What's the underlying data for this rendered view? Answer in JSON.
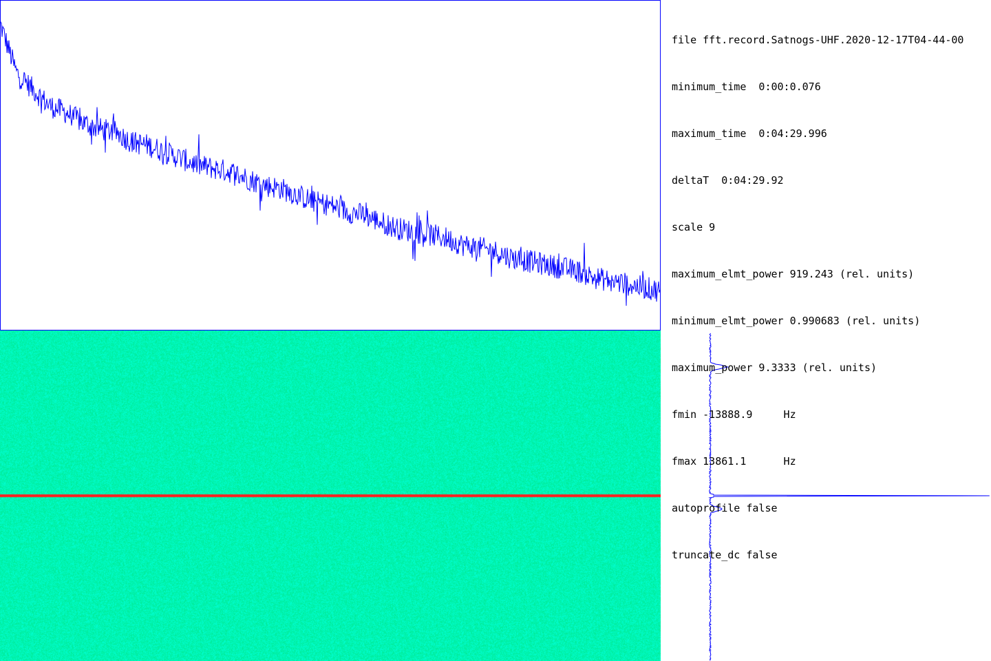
{
  "info": {
    "lines": [
      "file fft.record.Satnogs-UHF.2020-12-17T04-44-00",
      "minimum_time  0:00:0.076",
      "maximum_time  0:04:29.996",
      "deltaT  0:04:29.92",
      "scale 9",
      "maximum_elmt_power 919.243 (rel. units)",
      "minimum_elmt_power 0.990683 (rel. units)",
      "maximum_power 9.3333 (rel. units)",
      "fmin -13888.9     Hz",
      "fmax 13861.1      Hz",
      "autoprofile false",
      "truncate_dc false"
    ]
  },
  "colors": {
    "trace": "#0000ff",
    "waterfall_base": "#00ffc0",
    "dc_line": "#ff2020",
    "background": "#ffffff"
  },
  "chart_data": [
    {
      "type": "line",
      "title": "",
      "xlabel": "",
      "ylabel": "",
      "x_range": [
        0,
        1
      ],
      "y_range": [
        0,
        1
      ],
      "grid": false,
      "series": [
        {
          "values": [
            0.93,
            0.78,
            0.73,
            0.68,
            0.66,
            0.63,
            0.61,
            0.6,
            0.57,
            0.56,
            0.54,
            0.52,
            0.5,
            0.49,
            0.48,
            0.46,
            0.44,
            0.43,
            0.41,
            0.39,
            0.38,
            0.36,
            0.35,
            0.33,
            0.31,
            0.3,
            0.29,
            0.28,
            0.26,
            0.25,
            0.24,
            0.22,
            0.21,
            0.2,
            0.19,
            0.18,
            0.16,
            0.15,
            0.14,
            0.13,
            0.12
          ]
        }
      ]
    },
    {
      "type": "heatmap",
      "title": "",
      "grid": false,
      "note_row_fraction": 0.5
    },
    {
      "type": "line",
      "title": "",
      "orientation": "vertical",
      "series": [
        {
          "peaks": [
            {
              "pos": 0.11,
              "value": 0.06
            },
            {
              "pos": 0.5,
              "value": 1.0
            },
            {
              "pos": 0.54,
              "value": 0.04
            }
          ]
        }
      ]
    }
  ]
}
